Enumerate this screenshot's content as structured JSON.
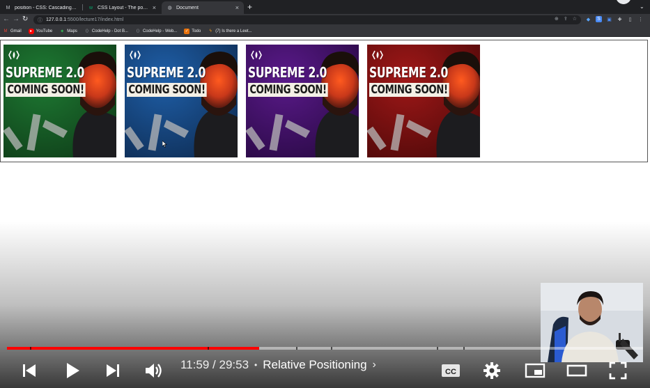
{
  "browser": {
    "tabs": [
      {
        "label": "position - CSS: Cascading Sty",
        "favicon": "mdn-icon",
        "active": false
      },
      {
        "label": "CSS Layout - The position Pro",
        "favicon": "w3schools-icon",
        "active": false
      },
      {
        "label": "Document",
        "favicon": "globe-icon",
        "active": true
      }
    ],
    "url_host": "127.0.0.1",
    "url_path": ":5500/lecture17/index.html",
    "bookmarks": [
      {
        "label": "Gmail",
        "icon": "gmail-icon"
      },
      {
        "label": "YouTube",
        "icon": "youtube-icon"
      },
      {
        "label": "Maps",
        "icon": "maps-icon"
      },
      {
        "label": "CodeHelp - Dot B...",
        "icon": "codehelp-icon"
      },
      {
        "label": "CodeHelp - Web...",
        "icon": "codehelp-icon"
      },
      {
        "label": "Todo",
        "icon": "todo-icon"
      },
      {
        "label": "(7) Is there a Leet...",
        "icon": "leetcode-icon"
      }
    ]
  },
  "page": {
    "cards": [
      {
        "line1": "SUPREME 2.0",
        "line2": "COMING SOON!",
        "bg": "#1e7a33",
        "bg2": "#0e3a17"
      },
      {
        "line1": "SUPREME 2.0",
        "line2": "COMING SOON!",
        "bg": "#1f5fa8",
        "bg2": "#0d2a50"
      },
      {
        "line1": "SUPREME 2.0",
        "line2": "COMING SOON!",
        "bg": "#5a1a8a",
        "bg2": "#260840"
      },
      {
        "line1": "SUPREME 2.0",
        "line2": "COMING SOON!",
        "bg": "#a01818",
        "bg2": "#4a0808"
      }
    ]
  },
  "player": {
    "time_current": "11:59",
    "time_separator": "/",
    "time_total": "29:53",
    "bullet": "•",
    "chapter": "Relative Positioning",
    "chapter_chevron": "›",
    "played_fraction": 0.396,
    "accent": "#ff0000"
  }
}
